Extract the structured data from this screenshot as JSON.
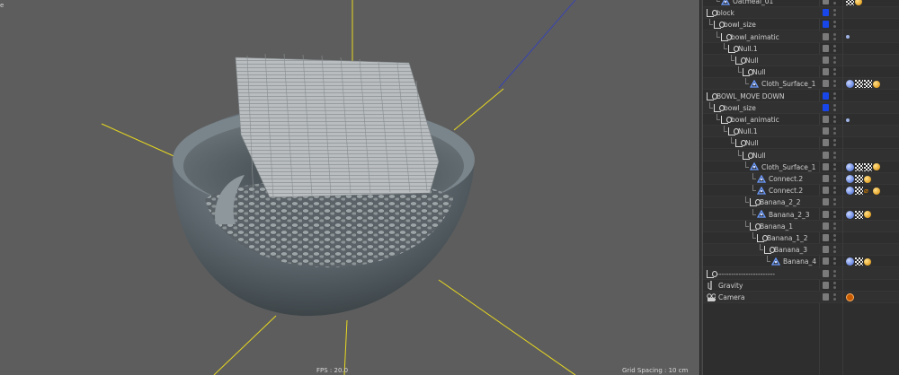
{
  "viewport": {
    "fps": "FPS : 20.0",
    "grid_spacing": "Grid Spacing : 10 cm",
    "corner_mark": "e"
  },
  "object_manager": {
    "rows": [
      {
        "name": "Oatmeal_01",
        "icon": "polygon-icon",
        "vis": "grey",
        "tags": [
          "checker-tag",
          "ball-tag"
        ]
      },
      {
        "name": "block",
        "icon": "null-icon",
        "vis": "blue",
        "tags": []
      },
      {
        "name": "bowl_size",
        "icon": "null-icon",
        "vis": "blue",
        "tags": []
      },
      {
        "name": "bowl_animatic",
        "icon": "null-icon",
        "vis": "grey",
        "tags": [
          "dot-tag"
        ]
      },
      {
        "name": "Null.1",
        "icon": "null-icon",
        "vis": "grey",
        "tags": []
      },
      {
        "name": "Null",
        "icon": "null-icon",
        "vis": "grey",
        "tags": []
      },
      {
        "name": "Null",
        "icon": "null-icon",
        "vis": "grey",
        "tags": []
      },
      {
        "name": "Cloth_Surface_1",
        "icon": "polygon-icon",
        "vis": "grey",
        "tags": [
          "dynamics-tag",
          "checker-tag",
          "checker-tag",
          "ball-tag"
        ]
      },
      {
        "name": "BOWL_MOVE DOWN",
        "icon": "null-icon",
        "vis": "blue",
        "tags": []
      },
      {
        "name": "bowl_size",
        "icon": "null-icon",
        "vis": "blue",
        "tags": []
      },
      {
        "name": "bowl_animatic",
        "icon": "null-icon",
        "vis": "grey",
        "tags": [
          "dot-tag"
        ]
      },
      {
        "name": "Null.1",
        "icon": "null-icon",
        "vis": "grey",
        "tags": []
      },
      {
        "name": "Null",
        "icon": "null-icon",
        "vis": "grey",
        "tags": []
      },
      {
        "name": "Null",
        "icon": "null-icon",
        "vis": "grey",
        "tags": []
      },
      {
        "name": "Cloth_Surface_1",
        "icon": "polygon-icon",
        "vis": "grey",
        "tags": [
          "dynamics-tag",
          "checker-tag",
          "checker-tag",
          "ball-tag"
        ]
      },
      {
        "name": "Connect.2",
        "icon": "polygon-icon",
        "vis": "grey",
        "tags": [
          "dynamics-tag",
          "checker-tag",
          "ball-tag"
        ]
      },
      {
        "name": "Connect.2",
        "icon": "polygon-icon",
        "vis": "grey",
        "tags": [
          "dynamics-tag",
          "checker-tag",
          "orange-tag",
          "ball-tag"
        ]
      },
      {
        "name": "Banana_2_2",
        "icon": "null-icon",
        "vis": "grey",
        "tags": []
      },
      {
        "name": "Banana_2_3",
        "icon": "polygon-icon",
        "vis": "grey",
        "tags": [
          "dynamics-tag",
          "checker-tag",
          "ball-tag"
        ]
      },
      {
        "name": "Banana_1",
        "icon": "null-icon",
        "vis": "grey",
        "tags": []
      },
      {
        "name": "Banana_1_2",
        "icon": "null-icon",
        "vis": "grey",
        "tags": []
      },
      {
        "name": "Banana_3",
        "icon": "null-icon",
        "vis": "grey",
        "tags": []
      },
      {
        "name": "Banana_4",
        "icon": "polygon-icon",
        "vis": "grey",
        "tags": [
          "dynamics-tag",
          "checker-tag",
          "ball-tag"
        ]
      },
      {
        "name": "------------------------",
        "icon": "null-icon",
        "vis": "grey",
        "tags": []
      },
      {
        "name": "Gravity",
        "icon": "gravity-icon",
        "vis": "grey",
        "tags": []
      },
      {
        "name": "Camera",
        "icon": "camera-icon",
        "vis": "grey",
        "tags": [
          "camera-tag"
        ]
      }
    ]
  },
  "colors": {
    "viewport_bg": "#5d5d5d",
    "panel_bg": "#2e2e2e",
    "visibility_blue": "#1846e8",
    "axis_yellow": "#e8d820"
  }
}
